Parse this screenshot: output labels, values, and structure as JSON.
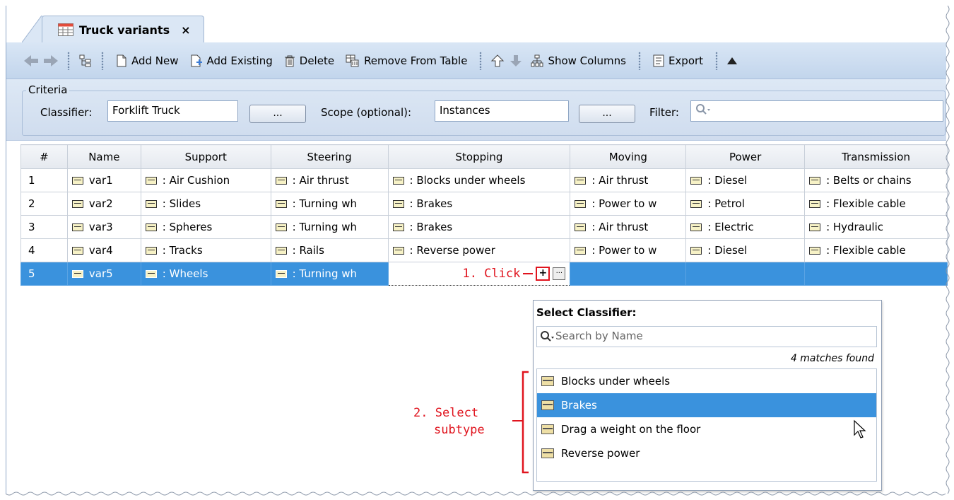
{
  "tab": {
    "title": "Truck variants",
    "close": "×"
  },
  "toolbar": {
    "add_new": "Add New",
    "add_existing": "Add Existing",
    "delete": "Delete",
    "remove_from_table": "Remove From Table",
    "show_columns": "Show Columns",
    "export": "Export"
  },
  "criteria": {
    "group_label": "Criteria",
    "classifier_label": "Classifier:",
    "classifier_value": "Forklift Truck",
    "browse": "...",
    "scope_label": "Scope (optional):",
    "scope_value": "Instances",
    "filter_label": "Filter:"
  },
  "table": {
    "columns": [
      "#",
      "Name",
      "Support",
      "Steering",
      "Stopping",
      "Moving",
      "Power",
      "Transmission"
    ],
    "rows": [
      [
        "1",
        "var1",
        ": Air Cushion",
        ": Air thrust",
        ": Blocks under wheels",
        ": Air thrust",
        ": Diesel",
        ": Belts or chains"
      ],
      [
        "2",
        "var2",
        ": Slides",
        ": Turning wh",
        ": Brakes",
        ": Power to w",
        ": Petrol",
        ": Flexible cable"
      ],
      [
        "3",
        "var3",
        ": Spheres",
        ": Turning wh",
        ": Brakes",
        ": Air thrust",
        ": Electric",
        ": Hydraulic"
      ],
      [
        "4",
        "var4",
        ": Tracks",
        ": Rails",
        ": Reverse power",
        ": Power to w",
        ": Diesel",
        ": Flexible cable"
      ],
      [
        "5",
        "var5",
        ": Wheels",
        ": Turning wh",
        "",
        "",
        "",
        ""
      ]
    ],
    "selected_row": 4
  },
  "editor": {
    "annotation": "1. Click",
    "browse": "..."
  },
  "popup": {
    "title": "Select Classifier:",
    "search_placeholder": "Search by Name",
    "count": "4 matches found",
    "items": [
      "Blocks under wheels",
      "Brakes",
      "Drag a weight on the floor",
      "Reverse power"
    ],
    "highlighted": 1
  },
  "annotation2": {
    "line1": "2. Select",
    "line2": "subtype"
  },
  "colors": {
    "accent": "#3a92dd",
    "annotation": "#e0141e",
    "toolbar": "#c9dbef"
  }
}
